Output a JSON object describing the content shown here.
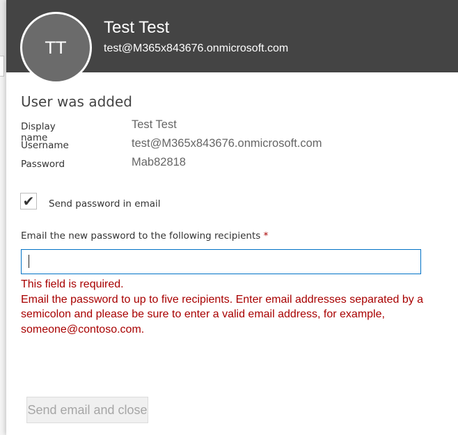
{
  "header": {
    "avatar_initials": "TT",
    "name": "Test Test",
    "email": "test@M365x843676.onmicrosoft.com"
  },
  "title": "User was added",
  "details": [
    {
      "label": "Display name",
      "value": "Test Test"
    },
    {
      "label": "Username",
      "value": "test@M365x843676.onmicrosoft.com"
    },
    {
      "label": "Password",
      "value": "Mab82818"
    }
  ],
  "send_password": {
    "label": "Send password in email",
    "checked": true
  },
  "recipients": {
    "label": "Email the new password to the following recipients",
    "required_marker": "*",
    "value": "",
    "error_required": "This field is required.",
    "error_help": "Email the password to up to five recipients. Enter email addresses separated by a semicolon and please be sure to enter a valid email address, for example, someone@contoso.com."
  },
  "actions": {
    "send_close_label": "Send email and close"
  },
  "colors": {
    "header_bg": "#444444",
    "error": "#a80000",
    "input_focus_border": "#0072c6"
  }
}
